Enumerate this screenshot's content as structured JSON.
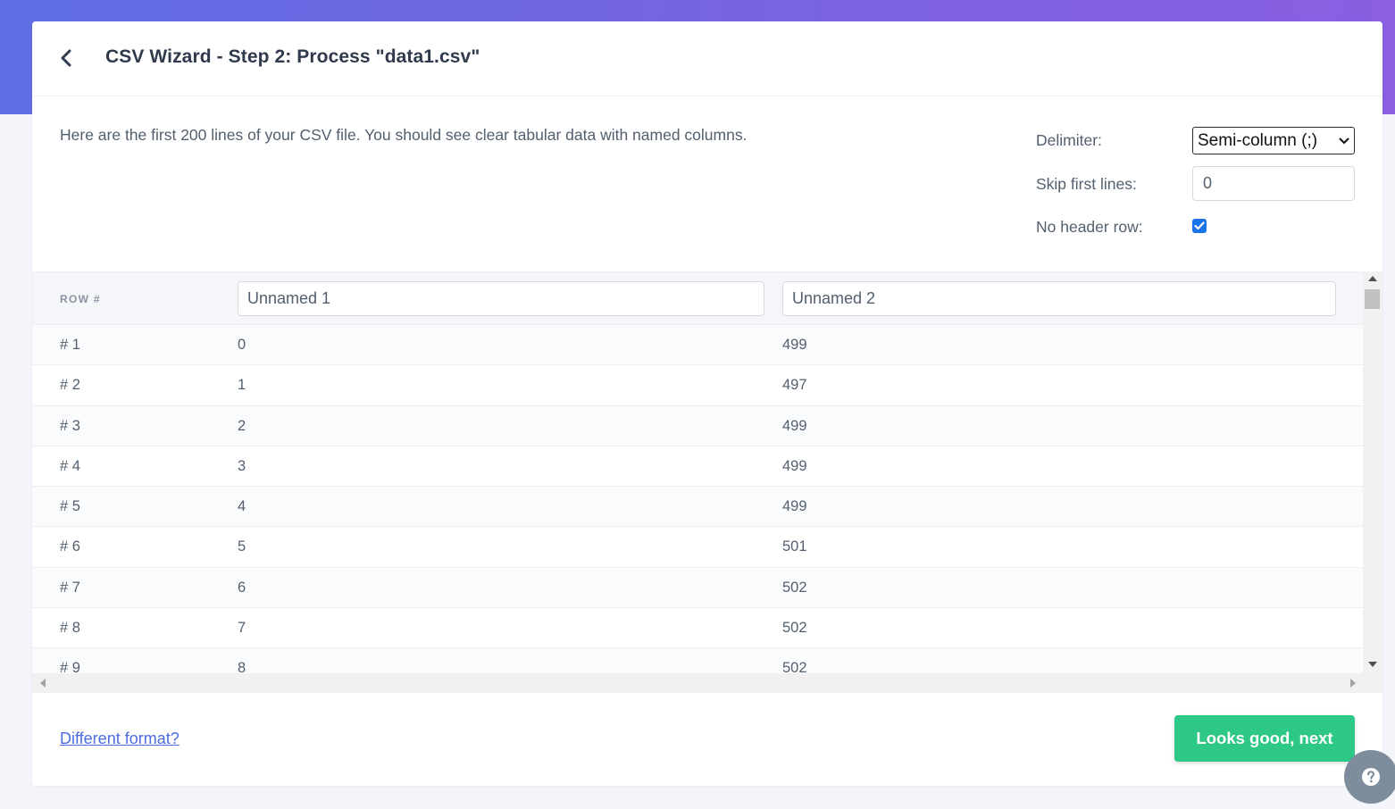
{
  "header": {
    "title": "CSV Wizard - Step 2: Process \"data1.csv\""
  },
  "intro_text": "Here are the first 200 lines of your CSV file. You should see clear tabular data with named columns.",
  "options": {
    "delimiter_label": "Delimiter:",
    "delimiter_value": "Semi-column (;)",
    "skip_label": "Skip first lines:",
    "skip_value": "0",
    "no_header_label": "No header row:",
    "no_header_checked": true
  },
  "table": {
    "row_header": "ROW #",
    "columns": [
      "Unnamed 1",
      "Unnamed 2"
    ],
    "rows": [
      [
        "# 1",
        "0",
        "499"
      ],
      [
        "# 2",
        "1",
        "497"
      ],
      [
        "# 3",
        "2",
        "499"
      ],
      [
        "# 4",
        "3",
        "499"
      ],
      [
        "# 5",
        "4",
        "499"
      ],
      [
        "# 6",
        "5",
        "501"
      ],
      [
        "# 7",
        "6",
        "502"
      ],
      [
        "# 8",
        "7",
        "502"
      ],
      [
        "# 9",
        "8",
        "502"
      ]
    ]
  },
  "footer": {
    "different_format": "Different format?",
    "next_button": "Looks good, next"
  },
  "colors": {
    "accent_gradient_start": "#5f6ee3",
    "accent_gradient_end": "#8a5fe2",
    "primary_button": "#2ec886",
    "link": "#4d6ce2",
    "checkbox": "#1a73e8"
  },
  "icons": {
    "back": "chevron-left-icon",
    "select_arrow": "chevron-down-icon",
    "checkbox": "checkmark-icon",
    "help": "question-mark-icon"
  }
}
